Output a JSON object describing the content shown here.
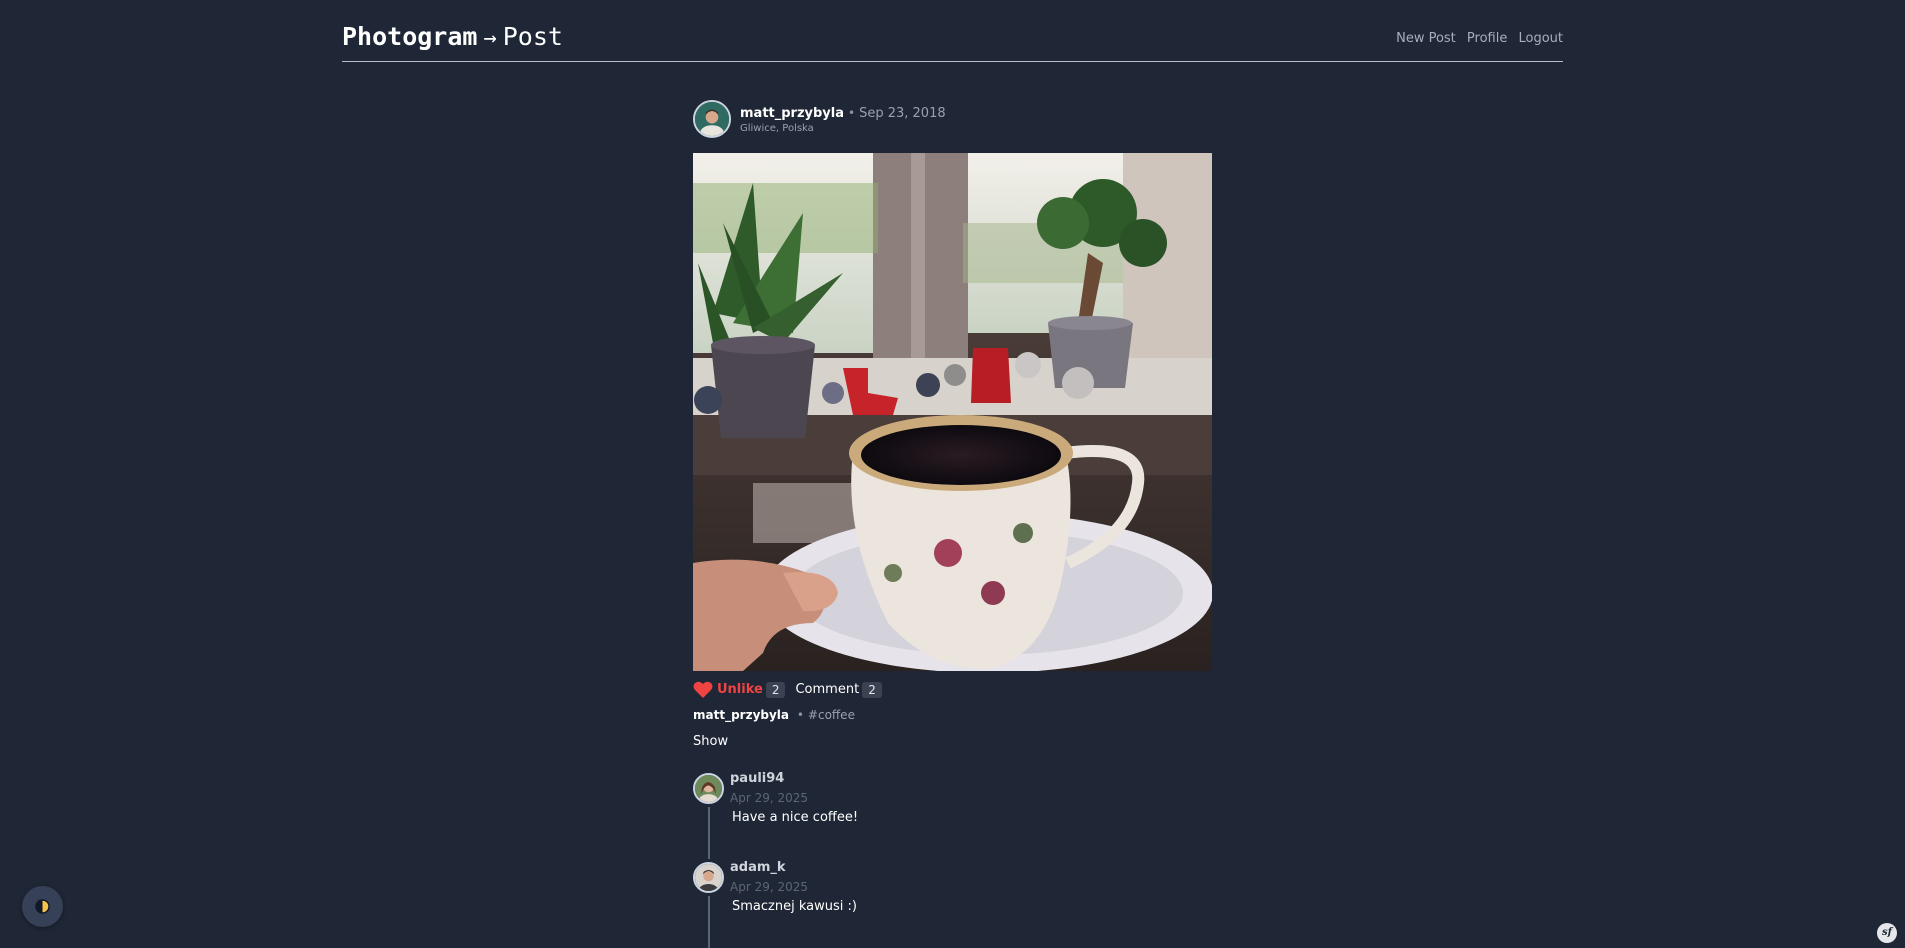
{
  "header": {
    "brand": "Photogram",
    "arrow": "→",
    "section": "Post",
    "nav": [
      "New Post",
      "Profile",
      "Logout"
    ]
  },
  "post": {
    "author": "matt_przybyla",
    "separator": "•",
    "date": "Sep 23, 2018",
    "location": "Gliwice, Polska",
    "like_label": "Unlike",
    "like_count": "2",
    "comment_label": "Comment",
    "comment_count": "2",
    "caption_user": "matt_przybyla",
    "hashtag": "#coffee",
    "show_label": "Show",
    "like_color": "#ef4444"
  },
  "comments": [
    {
      "user": "pauli94",
      "date": "Apr 29, 2025",
      "text": "Have a nice coffee!"
    },
    {
      "user": "adam_k",
      "date": "Apr 29, 2025",
      "text": "Smacznej kawusi :)"
    }
  ],
  "badge": "sf",
  "icons": [
    "heart-icon",
    "theme-toggle-icon",
    "avatar"
  ]
}
